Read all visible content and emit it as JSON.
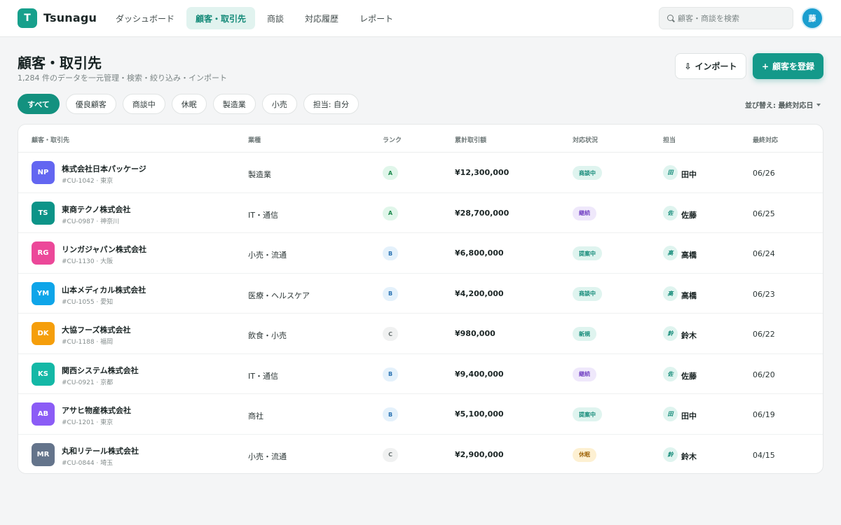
{
  "app": {
    "logo_letter": "T",
    "name": "Tsunagu"
  },
  "nav": [
    {
      "label": "ダッシュボード",
      "active": false
    },
    {
      "label": "顧客・取引先",
      "active": true
    },
    {
      "label": "商談",
      "active": false
    },
    {
      "label": "対応履歴",
      "active": false
    },
    {
      "label": "レポート",
      "active": false
    }
  ],
  "search": {
    "placeholder": "顧客・商談を検索"
  },
  "user": {
    "avatar_text": "藤"
  },
  "page": {
    "title": "顧客・取引先",
    "subtitle": "1,284 件のデータを一元管理・検索・絞り込み・インポート",
    "import_label": "インポート",
    "add_label": "顧客を登録"
  },
  "filters": [
    {
      "label": "すべて",
      "active": true
    },
    {
      "label": "優良顧客",
      "active": false
    },
    {
      "label": "商談中",
      "active": false
    },
    {
      "label": "休眠",
      "active": false
    },
    {
      "label": "製造業",
      "active": false
    },
    {
      "label": "小売",
      "active": false
    },
    {
      "label": "担当: 自分",
      "active": false
    }
  ],
  "sort": {
    "label": "並び替え: 最終対応日"
  },
  "table": {
    "columns": [
      "顧客・取引先",
      "業種",
      "ランク",
      "累計取引額",
      "対応状況",
      "担当",
      "最終対応"
    ],
    "rows": [
      {
        "initials": "NP",
        "color": "#6366f1",
        "name": "株式会社日本パッケージ",
        "meta": "#CU-1042 · 東京",
        "industry": "製造業",
        "rank": "A",
        "amount": "¥12,300,000",
        "status": "商談中",
        "status_tone": "teal",
        "owner_initial": "田",
        "owner": "田中",
        "last": "06/26"
      },
      {
        "initials": "TS",
        "color": "#0d9488",
        "name": "東商テクノ株式会社",
        "meta": "#CU-0987 · 神奈川",
        "industry": "IT・通信",
        "rank": "A",
        "amount": "¥28,700,000",
        "status": "継続",
        "status_tone": "purple",
        "owner_initial": "佐",
        "owner": "佐藤",
        "last": "06/25"
      },
      {
        "initials": "RG",
        "color": "#ec4899",
        "name": "リンガジャパン株式会社",
        "meta": "#CU-1130 · 大阪",
        "industry": "小売・流通",
        "rank": "B",
        "amount": "¥6,800,000",
        "status": "提案中",
        "status_tone": "teal",
        "owner_initial": "高",
        "owner": "高橋",
        "last": "06/24"
      },
      {
        "initials": "YM",
        "color": "#0ea5e9",
        "name": "山本メディカル株式会社",
        "meta": "#CU-1055 · 愛知",
        "industry": "医療・ヘルスケア",
        "rank": "B",
        "amount": "¥4,200,000",
        "status": "商談中",
        "status_tone": "teal",
        "owner_initial": "高",
        "owner": "高橋",
        "last": "06/23"
      },
      {
        "initials": "DK",
        "color": "#f59e0b",
        "name": "大協フーズ株式会社",
        "meta": "#CU-1188 · 福岡",
        "industry": "飲食・小売",
        "rank": "C",
        "amount": "¥980,000",
        "status": "新規",
        "status_tone": "teal",
        "owner_initial": "鈴",
        "owner": "鈴木",
        "last": "06/22"
      },
      {
        "initials": "KS",
        "color": "#14b8a6",
        "name": "関西システム株式会社",
        "meta": "#CU-0921 · 京都",
        "industry": "IT・通信",
        "rank": "B",
        "amount": "¥9,400,000",
        "status": "継続",
        "status_tone": "purple",
        "owner_initial": "佐",
        "owner": "佐藤",
        "last": "06/20"
      },
      {
        "initials": "AB",
        "color": "#8b5cf6",
        "name": "アサヒ物産株式会社",
        "meta": "#CU-1201 · 東京",
        "industry": "商社",
        "rank": "B",
        "amount": "¥5,100,000",
        "status": "提案中",
        "status_tone": "teal",
        "owner_initial": "田",
        "owner": "田中",
        "last": "06/19"
      },
      {
        "initials": "MR",
        "color": "#64748b",
        "name": "丸和リテール株式会社",
        "meta": "#CU-0844 · 埼玉",
        "industry": "小売・流通",
        "rank": "C",
        "amount": "¥2,900,000",
        "status": "休眠",
        "status_tone": "amber",
        "owner_initial": "鈴",
        "owner": "鈴木",
        "last": "04/15"
      }
    ]
  }
}
